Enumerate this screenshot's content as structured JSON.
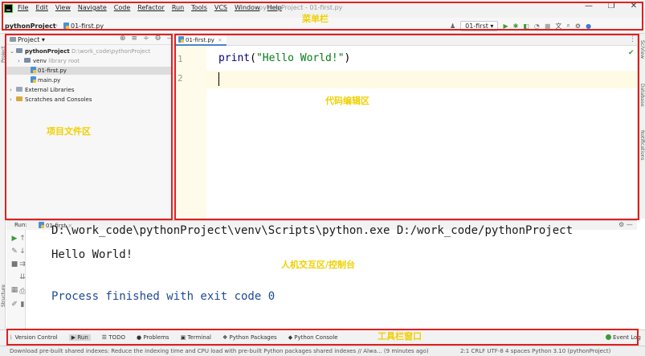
{
  "menubar": {
    "items": [
      "File",
      "Edit",
      "View",
      "Navigate",
      "Code",
      "Refactor",
      "Run",
      "Tools",
      "VCS",
      "Window",
      "Help"
    ],
    "window_title": "pythonProject - 01-first.py",
    "minimize": "—",
    "maximize": "❐",
    "close": "✕"
  },
  "navbar": {
    "project": "pythonProject",
    "separator": "›",
    "file": "01-first.py",
    "run_config": "01-first ▾"
  },
  "project_panel": {
    "title": "Project ▾",
    "tree": [
      {
        "label": "pythonProject",
        "detail": "D:\\work_code\\pythonProject"
      },
      {
        "label": "venv",
        "detail": "library root"
      },
      {
        "label": "01-first.py",
        "detail": ""
      },
      {
        "label": "main.py",
        "detail": ""
      },
      {
        "label": "External Libraries",
        "detail": ""
      },
      {
        "label": "Scratches and Consoles",
        "detail": ""
      }
    ]
  },
  "editor": {
    "tab": "01-first.py",
    "tab_close": "×",
    "line_numbers": [
      "1",
      "2"
    ],
    "code": {
      "fn": "print",
      "open": "(",
      "string": "\"Hello World!\"",
      "close": ")"
    }
  },
  "run_panel": {
    "label": "Run:",
    "tab": "01-first",
    "command": "D:\\work_code\\pythonProject\\venv\\Scripts\\python.exe D:/work_code/pythonProject",
    "output": "Hello World!",
    "finish": "Process finished with exit code 0"
  },
  "toolbar": {
    "items": [
      "Version Control",
      "Run",
      "TODO",
      "Problems",
      "Terminal",
      "Python Packages",
      "Python Console"
    ],
    "event_log": "Event Log"
  },
  "statusbar": {
    "message": "Download pre-built shared indexes: Reduce the indexing time and CPU load with pre-built Python packages shared indexes // Alwa... (9 minutes ago)",
    "right": "2:1   CRLF   UTF-8   4 spaces   Python 3.10 (pythonProject)"
  },
  "side_labels": {
    "left_top": "Project",
    "left_structure": "Structure",
    "left_bookmarks": "Bookmarks",
    "right_1": "SciView",
    "right_2": "Database",
    "right_3": "Notifications"
  },
  "annotations": {
    "menubar": "菜单栏",
    "editor": "代码编辑区",
    "project": "项目文件区",
    "console": "人机交互区/控制台",
    "toolbar": "工具栏窗口"
  },
  "colors": {
    "annotation_border": "#e02020",
    "annotation_text": "#f0d000",
    "string_green": "#067d17",
    "console_blue": "#1f4a94"
  }
}
